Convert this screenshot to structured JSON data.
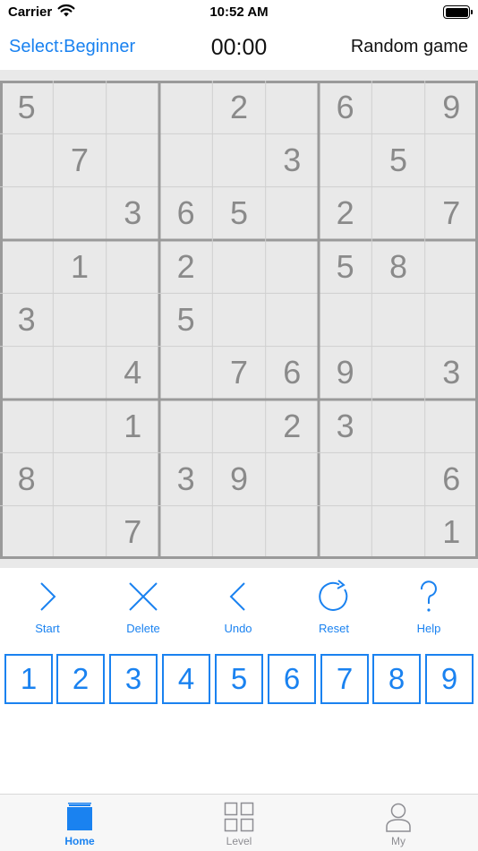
{
  "status": {
    "carrier": "Carrier",
    "time": "10:52 AM"
  },
  "nav": {
    "level_select": "Select:Beginner",
    "timer": "00:00",
    "random_game": "Random game"
  },
  "board": {
    "grid": [
      [
        "5",
        "",
        "",
        "",
        "2",
        "",
        "6",
        "",
        "9"
      ],
      [
        "",
        "7",
        "",
        "",
        "",
        "3",
        "",
        "5",
        ""
      ],
      [
        "",
        "",
        "3",
        "6",
        "5",
        "",
        "2",
        "",
        "7"
      ],
      [
        "",
        "1",
        "",
        "2",
        "",
        "",
        "5",
        "8",
        ""
      ],
      [
        "3",
        "",
        "",
        "5",
        "",
        "",
        "",
        "",
        ""
      ],
      [
        "",
        "",
        "4",
        "",
        "7",
        "6",
        "9",
        "",
        "3"
      ],
      [
        "",
        "",
        "1",
        "",
        "",
        "2",
        "3",
        "",
        ""
      ],
      [
        "8",
        "",
        "",
        "3",
        "9",
        "",
        "",
        "",
        "6"
      ],
      [
        "",
        "",
        "7",
        "",
        "",
        "",
        "",
        "",
        "1"
      ]
    ]
  },
  "toolbar": [
    {
      "label": "Start",
      "icon": "chevron-right-icon"
    },
    {
      "label": "Delete",
      "icon": "close-icon"
    },
    {
      "label": "Undo",
      "icon": "chevron-left-icon"
    },
    {
      "label": "Reset",
      "icon": "refresh-icon"
    },
    {
      "label": "Help",
      "icon": "question-icon"
    }
  ],
  "numpad": [
    "1",
    "2",
    "3",
    "4",
    "5",
    "6",
    "7",
    "8",
    "9"
  ],
  "tabs": [
    {
      "label": "Home",
      "icon": "home-icon",
      "active": true
    },
    {
      "label": "Level",
      "icon": "grid-icon",
      "active": false
    },
    {
      "label": "My",
      "icon": "person-icon",
      "active": false
    }
  ],
  "colors": {
    "accent": "#1a82f0",
    "board_bg": "#e9e9e9",
    "given_digit": "#8a8a8a",
    "grid_line": "#cfcfcf",
    "block_line": "#9a9a9a"
  }
}
